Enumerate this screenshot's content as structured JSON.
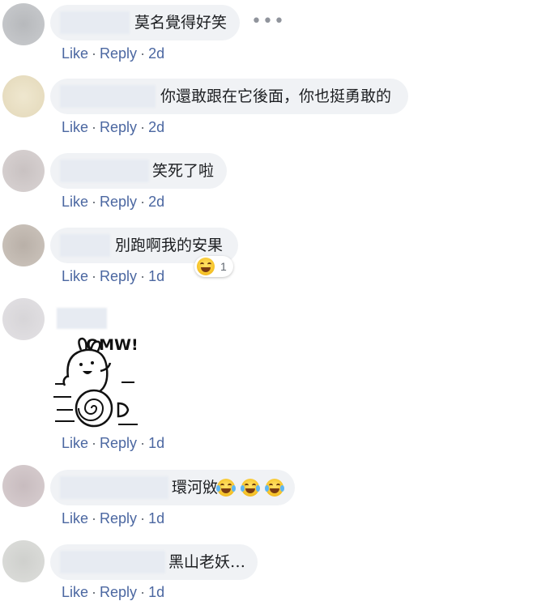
{
  "comments": [
    {
      "text": "莫名覺得好笑",
      "like": "Like",
      "reply": "Reply",
      "time": "2d",
      "more": "•••"
    },
    {
      "text": "你還敢跟在它後面，你也挺勇敢的",
      "like": "Like",
      "reply": "Reply",
      "time": "2d"
    },
    {
      "text": "笑死了啦",
      "like": "Like",
      "reply": "Reply",
      "time": "2d"
    },
    {
      "text": "別跑啊我的安果",
      "like": "Like",
      "reply": "Reply",
      "time": "1d",
      "reaction_count": "1"
    },
    {
      "sticker_text": "OMW!",
      "like": "Like",
      "reply": "Reply",
      "time": "1d"
    },
    {
      "text": "環河敓",
      "like": "Like",
      "reply": "Reply",
      "time": "1d"
    },
    {
      "text": "黑山老妖…",
      "like": "Like",
      "reply": "Reply",
      "time": "1d"
    }
  ],
  "colors": {
    "bubble": "#f0f2f5",
    "action_link": "#4b67a1",
    "text": "#1c1e21"
  }
}
